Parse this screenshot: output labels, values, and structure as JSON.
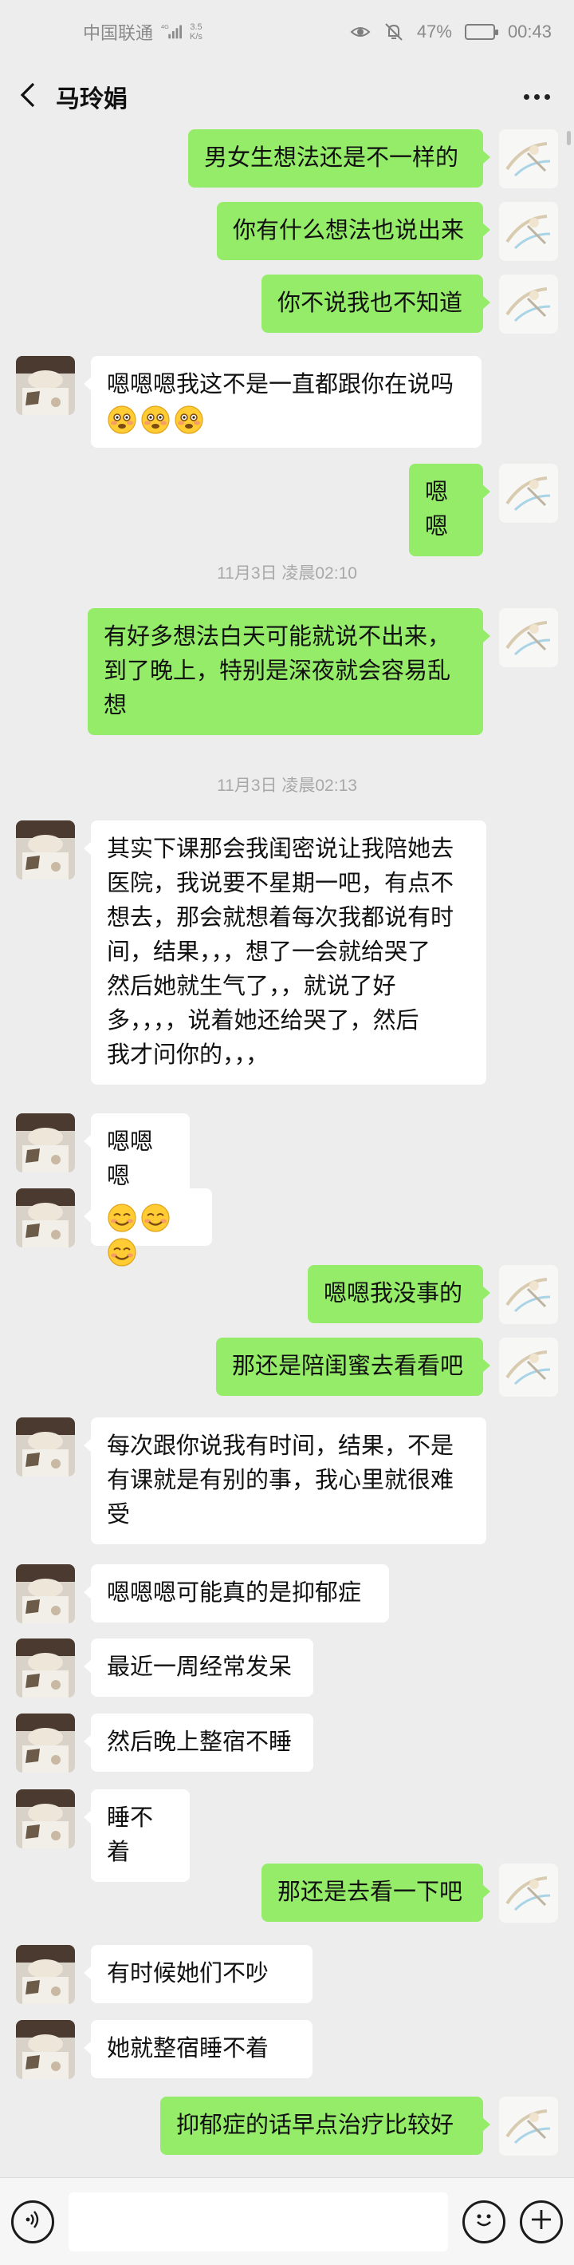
{
  "status_bar": {
    "carrier": "中国联通",
    "network_speed_value": "3.5",
    "network_speed_unit": "K/s",
    "battery_percent": "47%",
    "battery_level": 0.47,
    "time": "00:43"
  },
  "header": {
    "title": "马玲娟",
    "back_icon": "chevron-left-icon",
    "more_icon": "more-dots-icon"
  },
  "messages": [
    {
      "side": "right",
      "text": "男女生想法还是不一样的"
    },
    {
      "side": "right",
      "text": "你有什么想法也说出来"
    },
    {
      "side": "right",
      "text": "你不说我也不知道"
    },
    {
      "side": "left",
      "text": "嗯嗯嗯我这不是一直都跟你在说吗",
      "emojis": [
        "flushed-face",
        "flushed-face",
        "flushed-face"
      ]
    },
    {
      "side": "right",
      "text": "嗯嗯"
    },
    {
      "type": "time",
      "text": "11月3日 凌晨02:10"
    },
    {
      "side": "right",
      "lines": [
        "有好多想法白天可能就说不出来，",
        "到了晚上，特别是深夜就会容易乱",
        "想"
      ]
    },
    {
      "type": "time",
      "text": "11月3日 凌晨02:13"
    },
    {
      "side": "left",
      "lines": [
        "其实下课那会我闺密说让我陪她去",
        "医院，我说要不星期一吧，有点不",
        "想去，那会就想着每次我都说有时",
        "间，结果，，，想了一会就给哭了",
        "然后她就生气了，，就说了好",
        "多，，，，说着她还给哭了，然后",
        "我才问你的，，，"
      ]
    },
    {
      "side": "left",
      "text": "嗯嗯嗯"
    },
    {
      "side": "left",
      "emojis": [
        "smiling-face",
        "smiling-face",
        "smiling-face"
      ]
    },
    {
      "side": "right",
      "text": "嗯嗯我没事的"
    },
    {
      "side": "right",
      "text": "那还是陪闺蜜去看看吧"
    },
    {
      "side": "left",
      "lines": [
        "每次跟你说我有时间，结果，不是",
        "有课就是有别的事，我心里就很难",
        "受"
      ]
    },
    {
      "side": "left",
      "text": "嗯嗯嗯可能真的是抑郁症"
    },
    {
      "side": "left",
      "text": "最近一周经常发呆"
    },
    {
      "side": "left",
      "text": "然后晚上整宿不睡"
    },
    {
      "side": "left",
      "text": "睡不着"
    },
    {
      "side": "right",
      "text": "那还是去看一下吧"
    },
    {
      "side": "left",
      "text": "有时候她们不吵"
    },
    {
      "side": "left",
      "text": "她就整宿睡不着"
    },
    {
      "side": "right",
      "text": "抑郁症的话早点治疗比较好"
    }
  ],
  "input_bar": {
    "voice_icon": "voice-icon",
    "text_value": "",
    "emoji_icon": "emoji-icon",
    "plus_icon": "plus-icon"
  },
  "colors": {
    "background": "#ededed",
    "my_bubble": "#95ec69",
    "their_bubble": "#ffffff"
  }
}
